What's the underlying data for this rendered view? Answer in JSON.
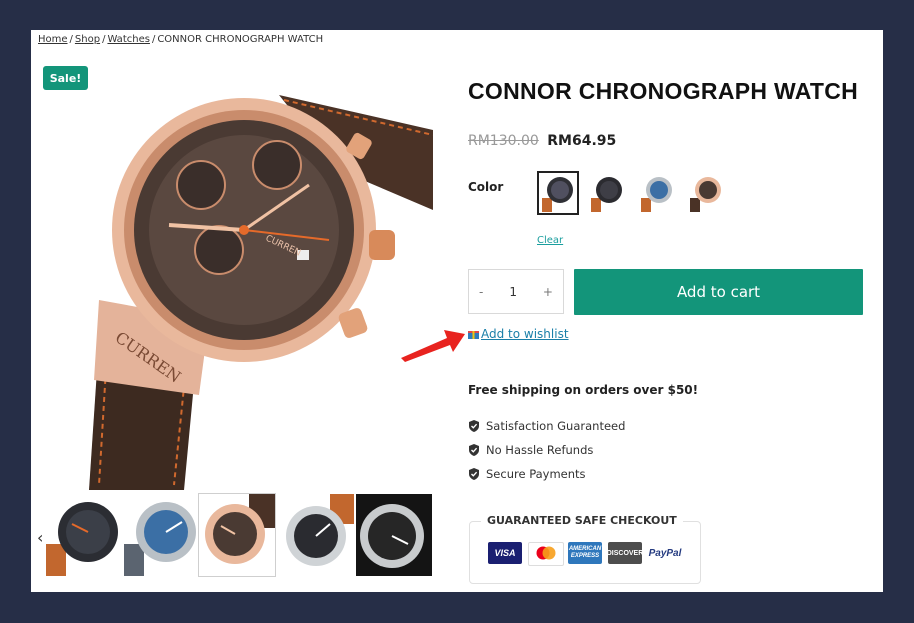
{
  "breadcrumb": {
    "items": [
      "Home",
      "Shop",
      "Watches"
    ],
    "current": "CONNOR CHRONOGRAPH WATCH",
    "separator": "/"
  },
  "badge": {
    "label": "Sale!"
  },
  "product": {
    "title": "CONNOR CHRONOGRAPH WATCH",
    "old_price": "RM130.00",
    "price": "RM64.95",
    "color_label": "Color",
    "swatches": [
      "brown-rose-gold-swatch",
      "black-orange-swatch",
      "blue-silver-swatch",
      "rose-gold-swatch"
    ],
    "selected_swatch": 0,
    "clear_label": "Clear",
    "quantity": {
      "minus": "-",
      "value": "1",
      "plus": "+"
    },
    "add_to_cart": "Add to cart",
    "wishlist": "Add to wishlist"
  },
  "shipping": {
    "text": "Free shipping on orders over $50!"
  },
  "features": [
    "Satisfaction Guaranteed",
    "No Hassle Refunds",
    "Secure Payments"
  ],
  "checkout": {
    "label": "GUARANTEED SAFE CHECKOUT",
    "methods": [
      {
        "name": "VISA",
        "color": "#1a1f71"
      },
      {
        "name": "mastercard",
        "color": "#ffffff"
      },
      {
        "name": "AMERICAN EXPRESS",
        "color": "#2e77bc"
      },
      {
        "name": "DISCOVER",
        "color": "#4d4d4d"
      },
      {
        "name": "PayPal",
        "color": "#ffffff"
      }
    ]
  },
  "thumbnails": {
    "prev_icon": "‹",
    "count": 5,
    "selected": 2
  },
  "colors": {
    "accent": "#13957a",
    "link": "#1a7fa8",
    "frame": "#262e47"
  }
}
